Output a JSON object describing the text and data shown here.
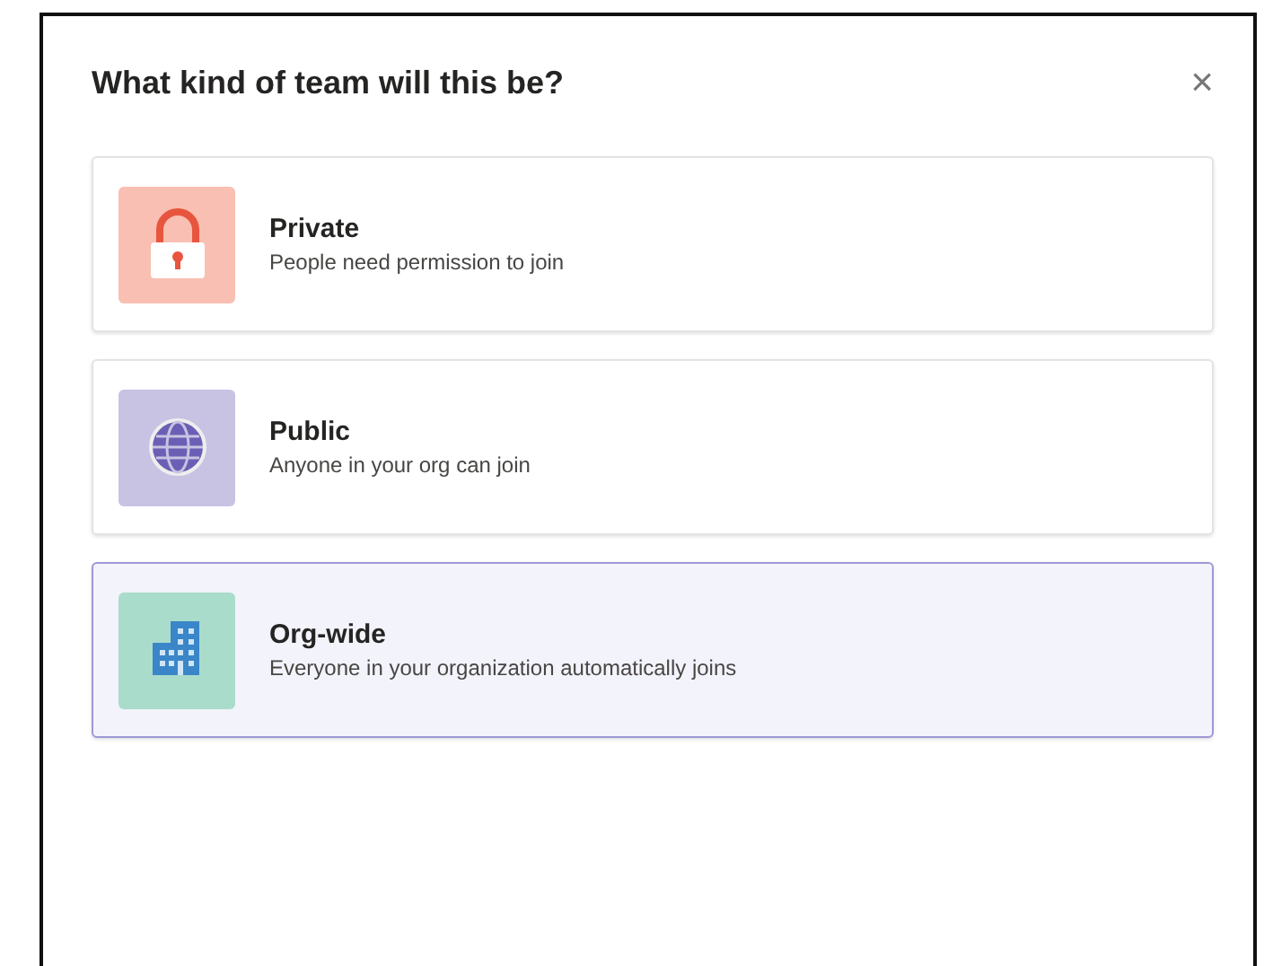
{
  "dialog": {
    "title": "What kind of team will this be?",
    "close": "×"
  },
  "options": [
    {
      "kind": "lock",
      "color": "#f8bfb2",
      "title": "Private",
      "description": "People need permission to join",
      "selected": false
    },
    {
      "kind": "globe",
      "color": "#c8c3e2",
      "title": "Public",
      "description": "Anyone in your org can join",
      "selected": false
    },
    {
      "kind": "building",
      "color": "#a9dccb",
      "title": "Org-wide",
      "description": "Everyone in your organization automatically joins",
      "selected": true
    }
  ]
}
